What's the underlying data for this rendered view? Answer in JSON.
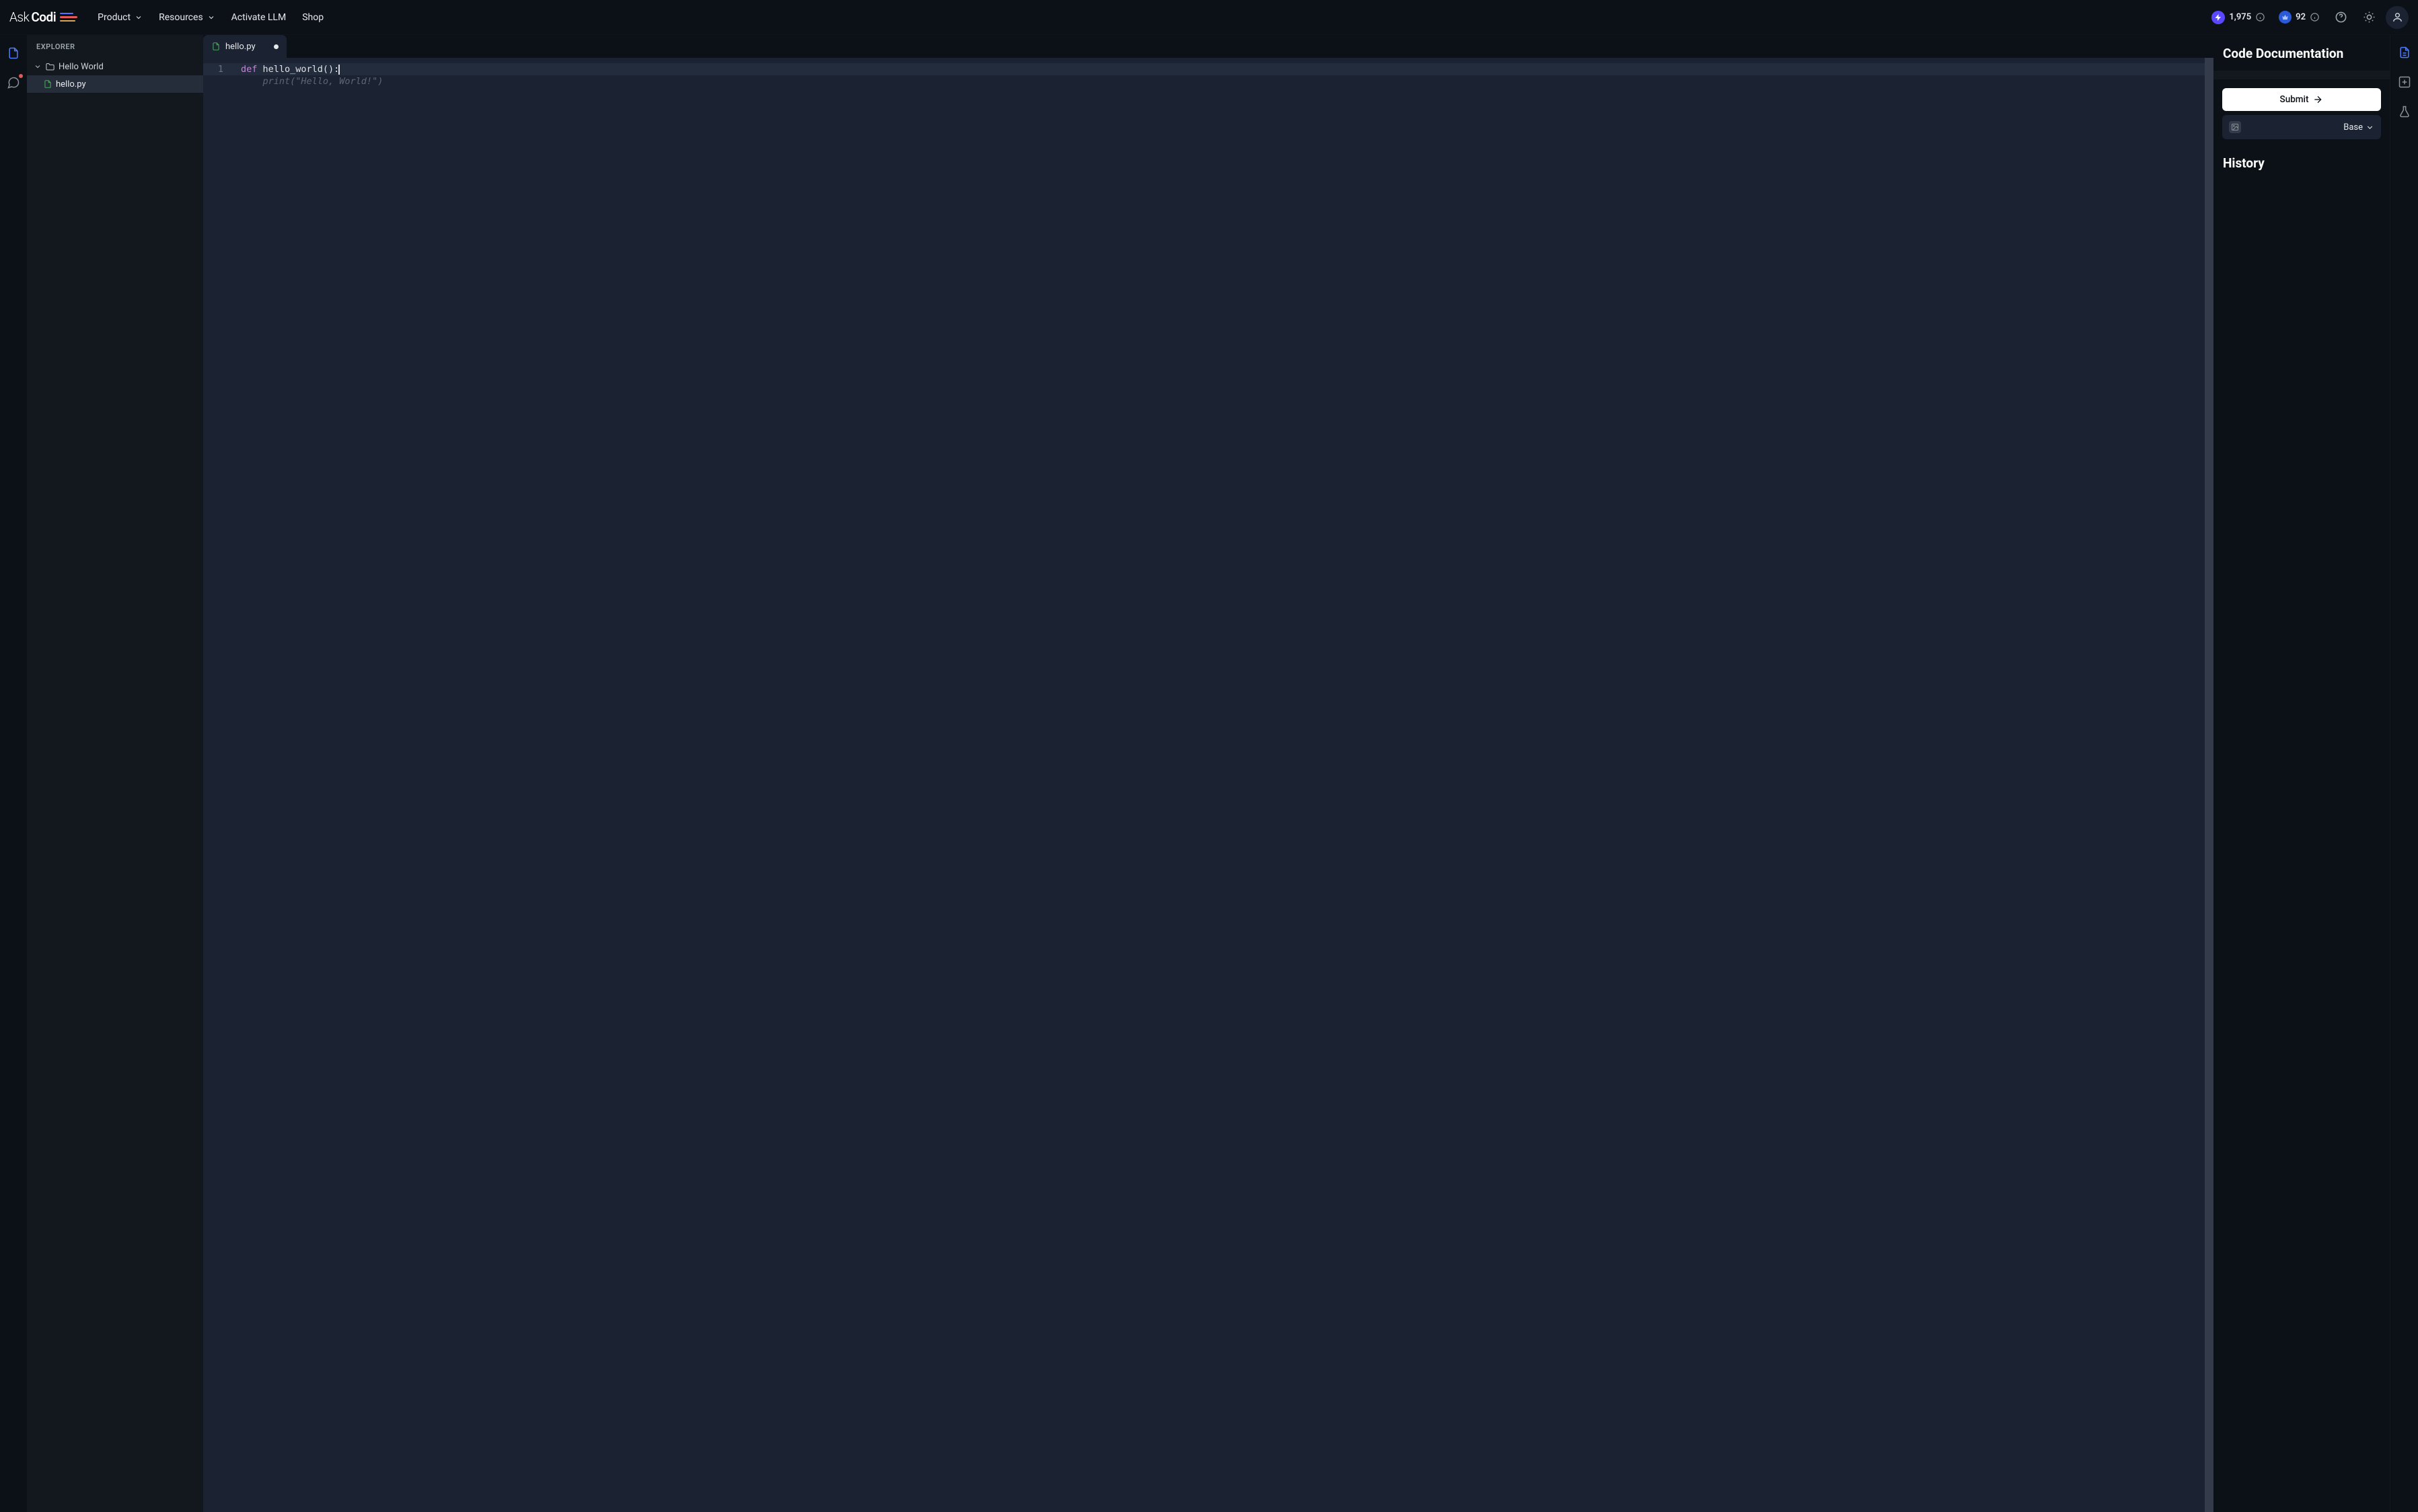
{
  "header": {
    "logo_thin": "Ask",
    "logo_bold": "Codi",
    "nav": {
      "product": "Product",
      "resources": "Resources",
      "activate": "Activate LLM",
      "shop": "Shop"
    },
    "stats": {
      "bolt_value": "1,975",
      "crown_value": "92"
    }
  },
  "explorer": {
    "title": "EXPLORER",
    "folder": {
      "name": "Hello World"
    },
    "files": {
      "f0": "hello.py"
    }
  },
  "tabs": {
    "t0": "hello.py"
  },
  "editor": {
    "line_numbers": {
      "l1": "1"
    },
    "tokens": {
      "def": "def",
      "rest": " hello_world():"
    },
    "ghost": "    print(\"Hello, World!\")"
  },
  "doc_panel": {
    "title": "Code Documentation",
    "submit": "Submit",
    "mode": "Base",
    "history": "History"
  }
}
